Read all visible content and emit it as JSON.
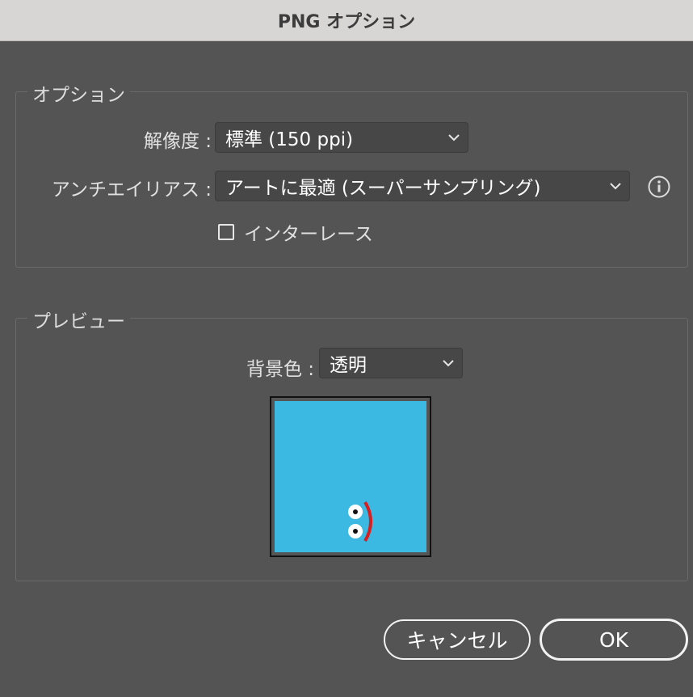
{
  "window": {
    "title": "PNG オプション"
  },
  "options_group": {
    "legend": "オプション",
    "resolution": {
      "label": "解像度 :",
      "value": "標準 (150 ppi)"
    },
    "antialias": {
      "label": "アンチエイリアス :",
      "value": "アートに最適 (スーパーサンプリング)",
      "info_icon": "info-icon"
    },
    "interlace": {
      "label": "インターレース",
      "checked": false
    }
  },
  "preview_group": {
    "legend": "プレビュー",
    "background": {
      "label": "背景色 :",
      "value": "透明"
    },
    "thumbnail": {
      "background_color": "#3bb9e3",
      "mouth_color": "#d81e1e"
    }
  },
  "buttons": {
    "cancel": "キャンセル",
    "ok": "OK"
  },
  "colors": {
    "dialog_bg": "#545454",
    "titlebar_bg": "#d8d6d5"
  }
}
